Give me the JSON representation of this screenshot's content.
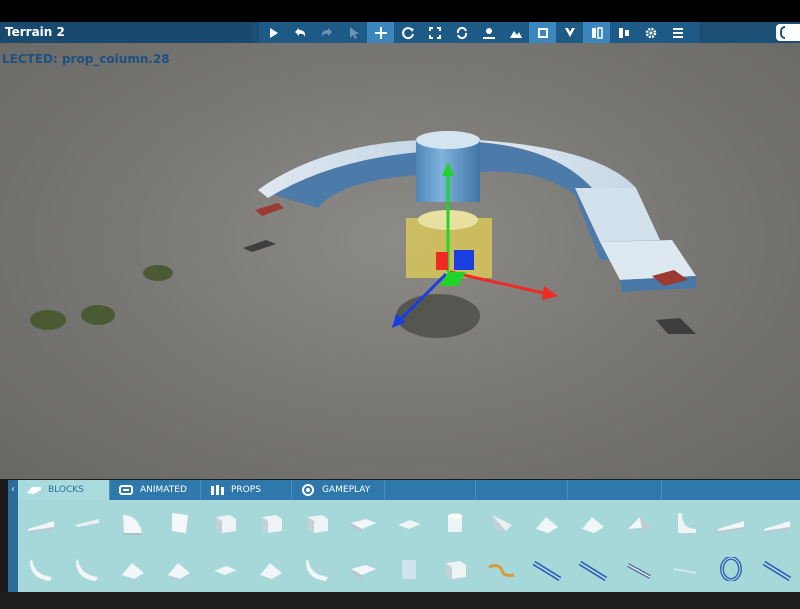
{
  "window": {
    "title": "Terrain 2"
  },
  "toolbar": {
    "tools": [
      {
        "name": "play-icon",
        "active": false,
        "dim": false
      },
      {
        "name": "undo-icon",
        "active": false,
        "dim": false
      },
      {
        "name": "redo-icon",
        "active": false,
        "dim": true
      },
      {
        "name": "select-cursor-icon",
        "active": false,
        "dim": true
      },
      {
        "name": "move-icon",
        "active": true,
        "dim": false
      },
      {
        "name": "rotate-icon",
        "active": false,
        "dim": false
      },
      {
        "name": "scale-icon",
        "active": false,
        "dim": false
      },
      {
        "name": "refresh-icon",
        "active": false,
        "dim": false
      },
      {
        "name": "snap-ground-icon",
        "active": false,
        "dim": false
      },
      {
        "name": "terrain-icon",
        "active": false,
        "dim": false
      },
      {
        "name": "local-space-icon",
        "active": true,
        "dim": false
      },
      {
        "name": "magnet-icon",
        "active": false,
        "dim": false
      },
      {
        "name": "split-view-icon",
        "active": true,
        "dim": false
      },
      {
        "name": "pivot-icon",
        "active": false,
        "dim": false
      },
      {
        "name": "settings-icon",
        "active": false,
        "dim": false
      },
      {
        "name": "menu-icon",
        "active": false,
        "dim": false
      }
    ]
  },
  "viewport": {
    "selected_label": "LECTED: prop_column.28"
  },
  "palette": {
    "tabs": [
      {
        "label": "BLOCKS",
        "icon": "blocks-icon",
        "selected": true
      },
      {
        "label": "ANIMATED",
        "icon": "animated-icon",
        "selected": false
      },
      {
        "label": "PROPS",
        "icon": "props-icon",
        "selected": false
      },
      {
        "label": "GAMEPLAY",
        "icon": "gameplay-icon",
        "selected": false
      }
    ],
    "items": [
      "ramp-block-icon",
      "wedge-thin-block-icon",
      "curved-block-icon",
      "angled-panel-icon",
      "cube-block-icon",
      "cube-block-icon",
      "cube-block-icon",
      "slab-block-icon",
      "flat-tile-icon",
      "cylinder-block-icon",
      "wedge-block-icon",
      "slope-block-icon",
      "slope-block-icon",
      "pyramid-block-icon",
      "quarter-pipe-icon",
      "ramp-block-icon",
      "ramp-block-icon",
      "curved-ramp-icon",
      "curved-ramp-icon",
      "slope-block-icon",
      "slope-block-icon",
      "flat-tile-icon",
      "slope-block-icon",
      "curved-ramp-icon",
      "slab-block-icon",
      "panel-block-icon",
      "cube-block-icon",
      "orange-rail-icon",
      "blue-track-icon",
      "blue-track-icon",
      "track-segment-icon",
      "thin-rail-icon",
      "loop-track-icon",
      "blue-track-icon"
    ]
  }
}
